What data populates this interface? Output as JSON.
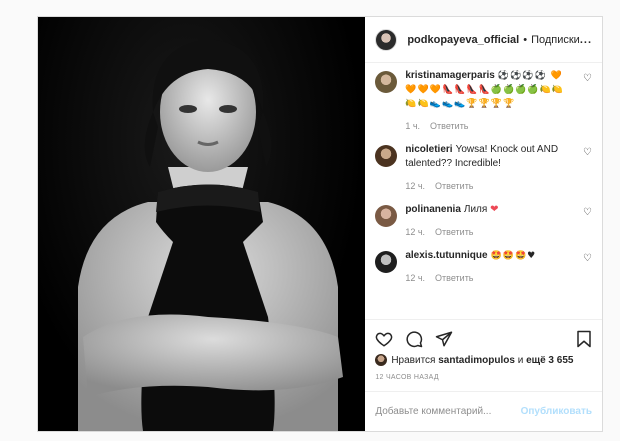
{
  "post": {
    "username": "podkopayeva_official",
    "follow_sep": "•",
    "follow_label": "Подписки",
    "more_label": "..."
  },
  "comments": [
    {
      "user": "kristinamagerparis",
      "text": "⚽⚽⚽⚽ 🧡🧡🧡🧡👠👠👠👠🍏🍏🍏🍏🍋🍋🍋🍋👟👟👟🏆🏆🏆🏆",
      "time": "1 ч.",
      "reply": "Ответить"
    },
    {
      "user": "nicoletieri",
      "text": "Yowsa! Knock out AND talented?? Incredible!",
      "time": "12 ч.",
      "reply": "Ответить"
    },
    {
      "user": "polinanenia",
      "text": "Лиля ❤",
      "time": "12 ч.",
      "reply": "Ответить"
    },
    {
      "user": "alexis.tutunnique",
      "text": "🤩🤩🤩♥",
      "time": "12 ч.",
      "reply": "Ответить"
    }
  ],
  "likes": {
    "prefix": "Нравится",
    "user": "santadimopulos",
    "and": "и",
    "more": "ещё 3 655"
  },
  "timestamp": "12 ЧАСОВ НАЗАД",
  "add_comment": {
    "placeholder": "Добавьте комментарий...",
    "publish": "Опубликовать"
  },
  "colors": {
    "accent_disabled": "#b2dffc",
    "muted": "#8e8e8e",
    "border": "#dbdbdb"
  }
}
